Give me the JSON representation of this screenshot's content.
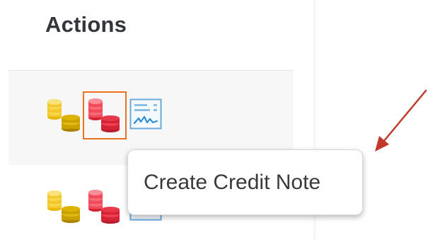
{
  "header": {
    "title": "Actions"
  },
  "rows": [
    {
      "icons": [
        "gold-coins-icon",
        "red-coins-icon",
        "signed-document-icon"
      ],
      "selected_icon": "red-coins-icon"
    },
    {
      "icons": [
        "gold-coins-icon",
        "red-coins-icon",
        "signed-document-icon"
      ]
    }
  ],
  "tooltip": {
    "text": "Create Credit Note"
  },
  "colors": {
    "gold": "#f3c82c",
    "gold_dark": "#c9a000",
    "red": "#f24a5a",
    "red_dark": "#d42434",
    "doc_blue": "#2c8fd8",
    "highlight": "#e9731f",
    "annotation_arrow": "#c0392b"
  }
}
